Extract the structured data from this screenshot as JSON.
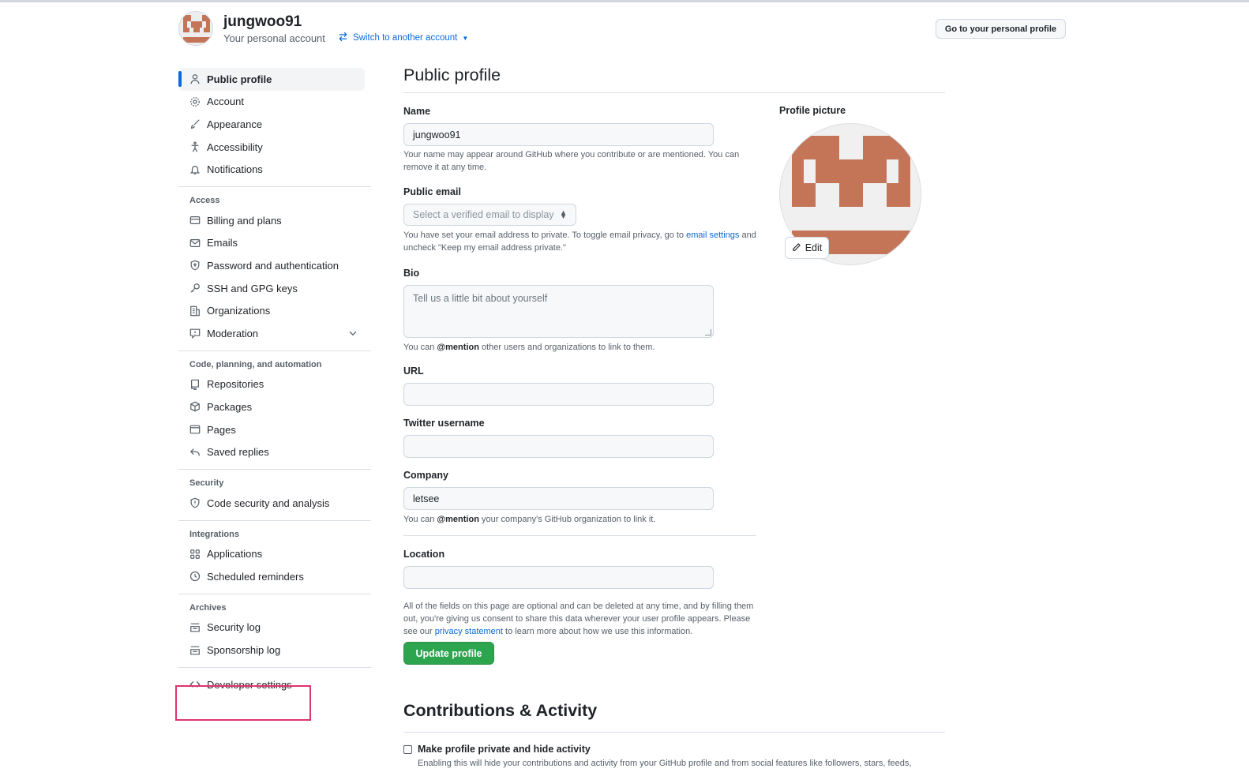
{
  "header": {
    "username": "jungwoo91",
    "account_type": "Your personal account",
    "switch_link": "Switch to another account",
    "go_profile_button": "Go to your personal profile"
  },
  "sidebar": {
    "top_items": [
      {
        "label": "Public profile",
        "icon": "person-icon",
        "active": true
      },
      {
        "label": "Account",
        "icon": "gear-icon"
      },
      {
        "label": "Appearance",
        "icon": "paintbrush-icon"
      },
      {
        "label": "Accessibility",
        "icon": "accessibility-icon"
      },
      {
        "label": "Notifications",
        "icon": "bell-icon"
      }
    ],
    "access_heading": "Access",
    "access_items": [
      {
        "label": "Billing and plans",
        "icon": "credit-card-icon"
      },
      {
        "label": "Emails",
        "icon": "mail-icon"
      },
      {
        "label": "Password and authentication",
        "icon": "shield-lock-icon"
      },
      {
        "label": "SSH and GPG keys",
        "icon": "key-icon"
      },
      {
        "label": "Organizations",
        "icon": "organization-icon"
      },
      {
        "label": "Moderation",
        "icon": "report-icon"
      }
    ],
    "code_heading": "Code, planning, and automation",
    "code_items": [
      {
        "label": "Repositories",
        "icon": "repo-icon"
      },
      {
        "label": "Packages",
        "icon": "package-icon"
      },
      {
        "label": "Pages",
        "icon": "browser-icon"
      },
      {
        "label": "Saved replies",
        "icon": "reply-icon"
      }
    ],
    "security_heading": "Security",
    "security_items": [
      {
        "label": "Code security and analysis",
        "icon": "codescan-icon"
      }
    ],
    "integrations_heading": "Integrations",
    "integrations_items": [
      {
        "label": "Applications",
        "icon": "apps-icon"
      },
      {
        "label": "Scheduled reminders",
        "icon": "clock-icon"
      }
    ],
    "archives_heading": "Archives",
    "archives_items": [
      {
        "label": "Security log",
        "icon": "log-icon"
      },
      {
        "label": "Sponsorship log",
        "icon": "log-icon"
      }
    ],
    "developer_settings": "Developer settings"
  },
  "main": {
    "title": "Public profile",
    "name_label": "Name",
    "name_value": "jungwoo91",
    "name_hint": "Your name may appear around GitHub where you contribute or are mentioned. You can remove it at any time.",
    "email_label": "Public email",
    "email_select": "Select a verified email to display",
    "email_hint_1": "You have set your email address to private. To toggle email privacy, go to",
    "email_hint_link": "email settings",
    "email_hint_2": "and uncheck \"Keep my email address private.\"",
    "bio_label": "Bio",
    "bio_placeholder": "Tell us a little bit about yourself",
    "bio_hint_1": "You can",
    "bio_hint_mention": "@mention",
    "bio_hint_2": "other users and organizations to link to them.",
    "url_label": "URL",
    "url_value": "",
    "twitter_label": "Twitter username",
    "twitter_value": "",
    "company_label": "Company",
    "company_value": "letsee",
    "company_hint_1": "You can",
    "company_hint_mention": "@mention",
    "company_hint_2": "your company's GitHub organization to link it.",
    "location_label": "Location",
    "location_value": "",
    "footer_hint_1": "All of the fields on this page are optional and can be deleted at any time, and by filling them out, you're giving us consent to share this data wherever your user profile appears. Please see our",
    "footer_hint_link": "privacy statement",
    "footer_hint_2": "to learn more about how we use this information.",
    "update_button": "Update profile",
    "picture_label": "Profile picture",
    "edit_button": "Edit",
    "contrib_title": "Contributions & Activity",
    "private_checkbox_label": "Make profile private and hide activity",
    "private_checkbox_checked": false,
    "private_checkbox_hint": "Enabling this will hide your contributions and activity from your GitHub profile and from social features like followers, stars, feeds,"
  },
  "colors": {
    "accent": "#0969da",
    "identicon": "#c47557",
    "update_button": "#2da44e",
    "highlight_box": "#e0336b"
  }
}
